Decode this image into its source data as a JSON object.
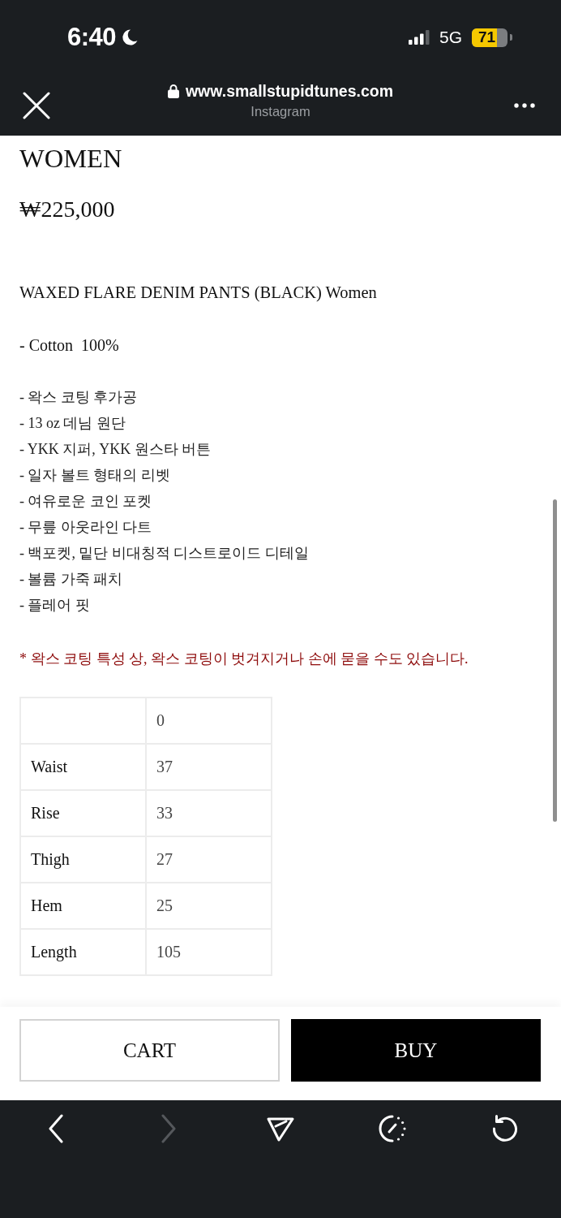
{
  "status_bar": {
    "time": "6:40",
    "do_not_disturb": true,
    "network": "5G",
    "battery": "71"
  },
  "browser_header": {
    "url": "www.smallstupidtunes.com",
    "secure": true,
    "source": "Instagram"
  },
  "product": {
    "category": "WOMEN",
    "price": "₩225,000",
    "name": "WAXED FLARE DENIM PANTS (BLACK) Women",
    "material": "- Cotton  100%",
    "features": [
      "- 왁스 코팅 후가공",
      "- 13 oz 데님 원단",
      "- YKK 지퍼, YKK 원스타 버튼",
      "- 일자 볼트 형태의 리벳",
      "- 여유로운 코인 포켓",
      "- 무릎 아웃라인 다트",
      "- 백포켓, 밑단 비대칭적 디스트로이드 디테일",
      "- 볼륨 가죽 패치",
      "- 플레어 핏"
    ],
    "notice": "* 왁스 코팅 특성 상, 왁스 코팅이 벗겨지거나 손에 묻을 수도 있습니다."
  },
  "size_table": {
    "column_2_header": "0",
    "rows": [
      {
        "measure": "Waist",
        "value": "37"
      },
      {
        "measure": "Rise",
        "value": "33"
      },
      {
        "measure": "Thigh",
        "value": "27"
      },
      {
        "measure": "Hem",
        "value": "25"
      },
      {
        "measure": "Length",
        "value": "105"
      }
    ]
  },
  "actions": [
    {
      "label": "CART",
      "kind": "outline"
    },
    {
      "label": "BUY",
      "kind": "filled"
    }
  ],
  "toolbar": [
    {
      "kind": "back",
      "disabled": false
    },
    {
      "kind": "forward",
      "disabled": true
    },
    {
      "kind": "share",
      "disabled": false
    },
    {
      "kind": "timer",
      "disabled": false
    },
    {
      "kind": "reload",
      "disabled": false
    }
  ]
}
